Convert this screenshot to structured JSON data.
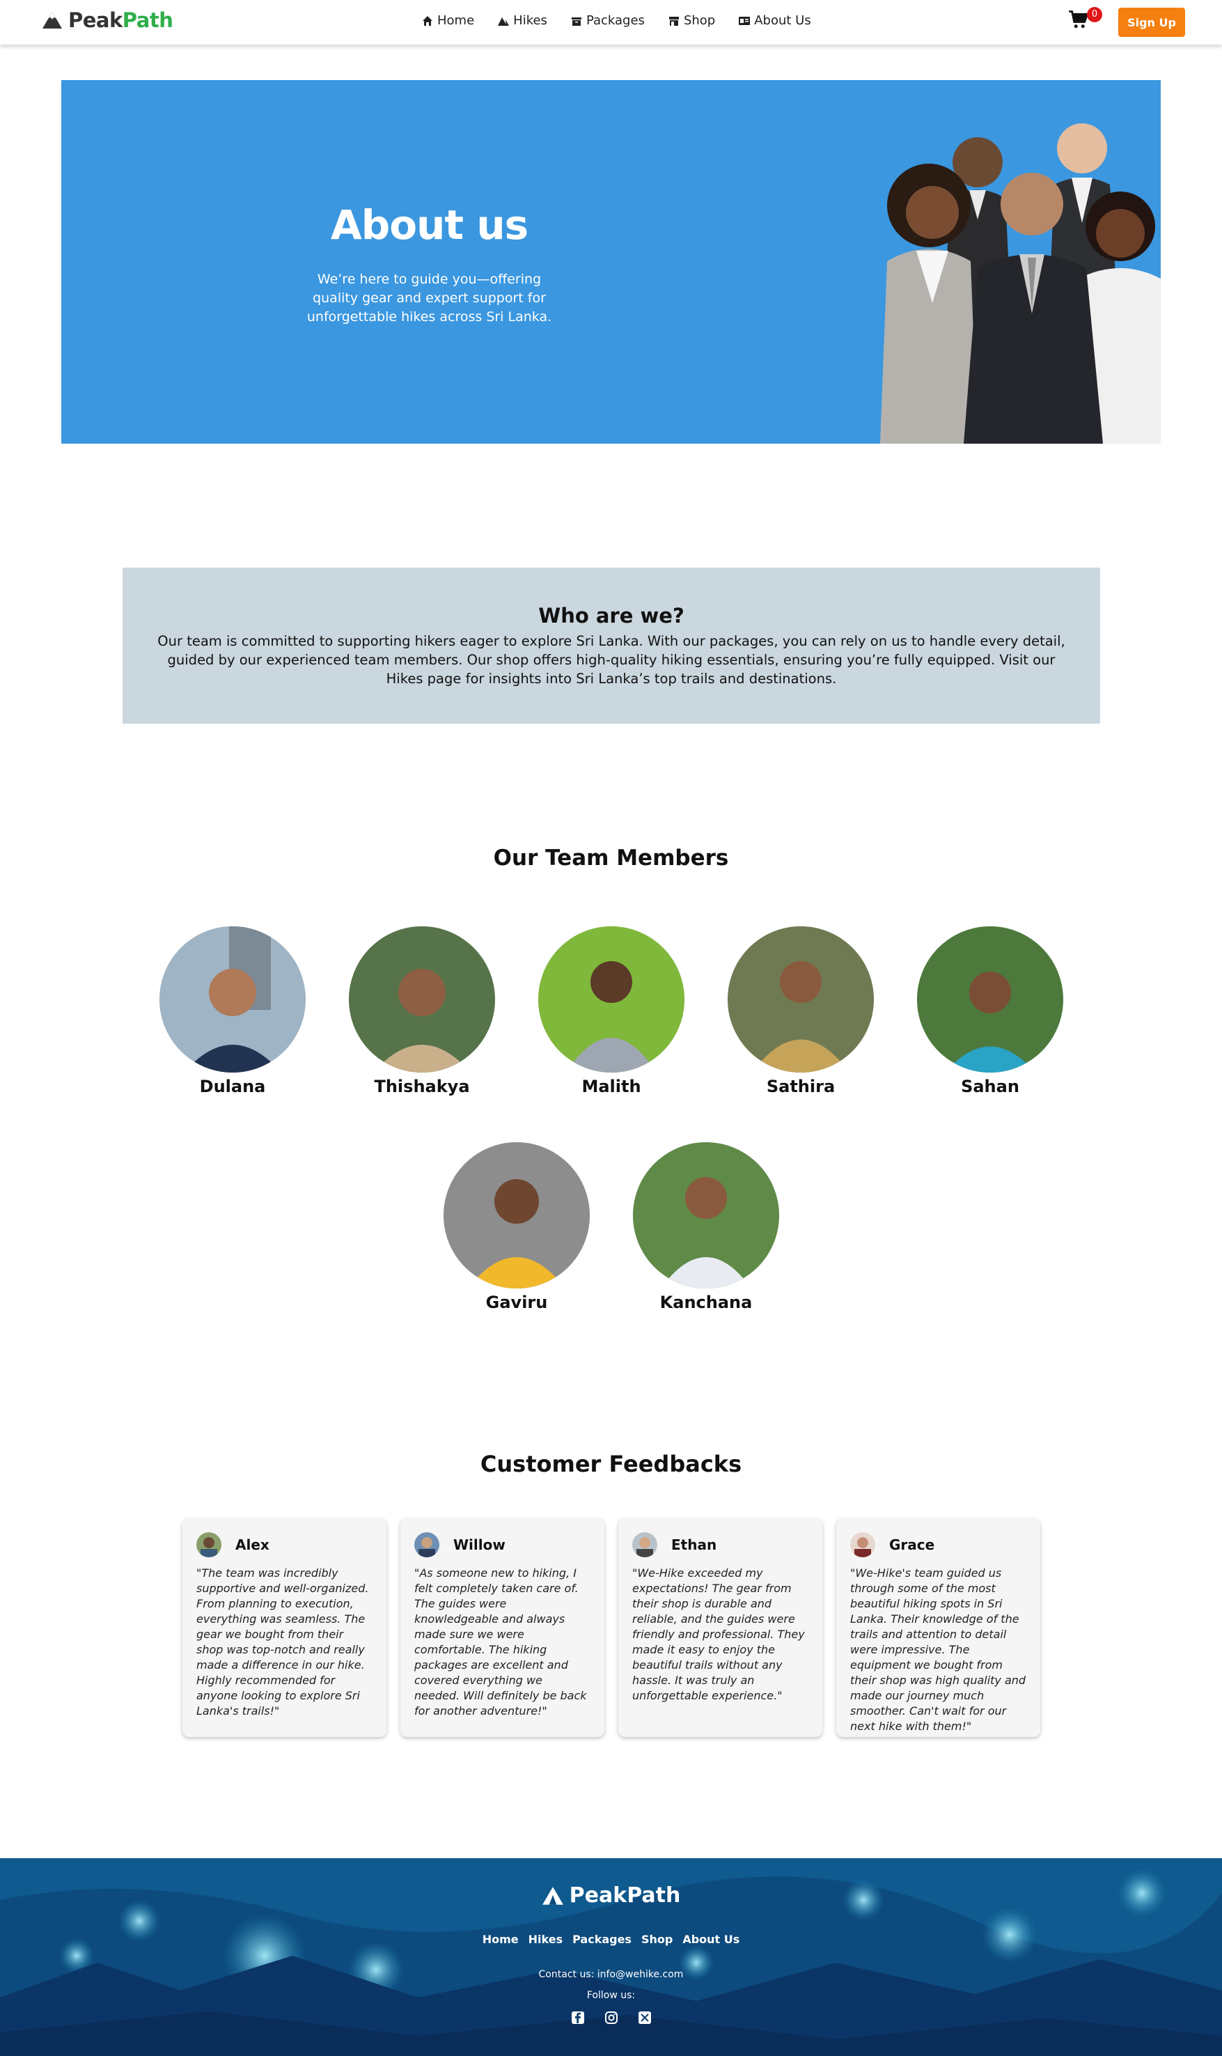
{
  "brand": {
    "part1": "Peak",
    "part2": "Path"
  },
  "nav": {
    "items": [
      {
        "label": "Home",
        "icon": "home-icon"
      },
      {
        "label": "Hikes",
        "icon": "mountain-icon"
      },
      {
        "label": "Packages",
        "icon": "package-icon"
      },
      {
        "label": "Shop",
        "icon": "shop-icon"
      },
      {
        "label": "About Us",
        "icon": "id-card-icon"
      }
    ],
    "cart_count": "0",
    "signup_label": "Sign Up"
  },
  "hero": {
    "title": "About us",
    "subtitle": "We’re here to guide you—offering quality gear and expert support for unforgettable hikes across Sri Lanka."
  },
  "who": {
    "title": "Who are we?",
    "text": "Our team is committed to supporting hikers eager to explore Sri Lanka. With our packages, you can rely on us to handle every detail, guided by our experienced team members. Our shop offers high-quality hiking essentials, ensuring you’re fully equipped. Visit our Hikes page for insights into Sri Lanka’s top trails and destinations."
  },
  "team": {
    "title": "Our Team Members",
    "members": [
      {
        "name": "Dulana"
      },
      {
        "name": "Thishakya"
      },
      {
        "name": "Malith"
      },
      {
        "name": "Sathira"
      },
      {
        "name": "Sahan"
      },
      {
        "name": "Gaviru"
      },
      {
        "name": "Kanchana"
      }
    ]
  },
  "feedback": {
    "title": "Customer Feedbacks",
    "items": [
      {
        "name": "Alex",
        "quote": "\"The team was incredibly supportive and well-organized. From planning to execution, everything was seamless. The gear we bought from their shop was top-notch and really made a difference in our hike. Highly recommended for anyone looking to explore Sri Lanka's trails!\""
      },
      {
        "name": "Willow",
        "quote": "\"As someone new to hiking, I felt completely taken care of. The guides were knowledgeable and always made sure we were comfortable. The hiking packages are excellent and covered everything we needed. Will definitely be back for another adventure!\""
      },
      {
        "name": "Ethan",
        "quote": "\"We-Hike exceeded my expectations! The gear from their shop is durable and reliable, and the guides were friendly and professional. They made it easy to enjoy the beautiful trails without any hassle. It was truly an unforgettable experience.\""
      },
      {
        "name": "Grace",
        "quote": "\"We-Hike's team guided us through some of the most beautiful hiking spots in Sri Lanka. Their knowledge of the trails and attention to detail were impressive. The equipment we bought from their shop was high quality and made our journey much smoother. Can't wait for our next hike with them!\""
      }
    ]
  },
  "footer": {
    "brand": "PeakPath",
    "links": [
      "Home",
      "Hikes",
      "Packages",
      "Shop",
      "About Us"
    ],
    "contact": "Contact us: info@wehike.com",
    "follow": "Follow us:",
    "social": [
      "facebook-icon",
      "instagram-icon",
      "x-icon"
    ]
  },
  "colors": {
    "accent": "#f57f11",
    "hero_bg": "#3b97df",
    "brand_green": "#2fae4a",
    "who_bg": "#cbd7df"
  }
}
